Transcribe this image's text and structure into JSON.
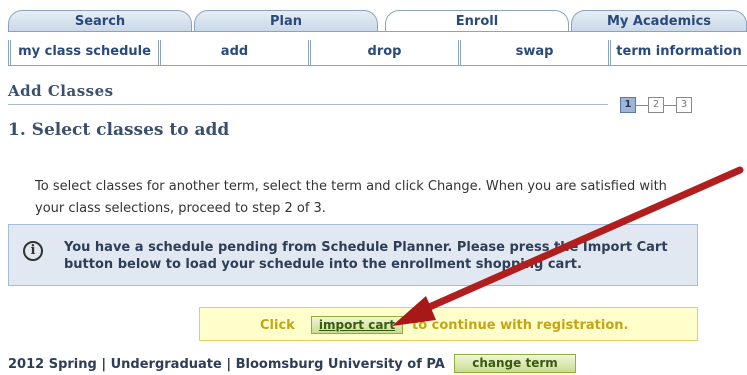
{
  "tabs": {
    "search": "Search",
    "plan": "Plan",
    "enroll": "Enroll",
    "my_academics": "My Academics"
  },
  "subtabs": {
    "my_class_schedule": "my class schedule",
    "add": "add",
    "drop": "drop",
    "swap": "swap",
    "term_information": "term information"
  },
  "page": {
    "title": "Add Classes",
    "step_heading": "1.  Select classes to add",
    "steps": [
      "1",
      "2",
      "3"
    ],
    "active_step": 1,
    "intro_text": "To select classes for another term, select the term and click Change.  When you are satisfied with your class selections, proceed to step 2 of 3."
  },
  "info": {
    "icon": "info-icon",
    "message": "You have a schedule pending from Schedule Planner. Please press the Import Cart button below to load your schedule into the enrollment shopping cart."
  },
  "import": {
    "click_label": "Click",
    "button_label": "import cart",
    "continue_text": "to continue with registration."
  },
  "term": {
    "text": "2012 Spring | Undergraduate | Bloomsburg University of PA",
    "change_button": "change term"
  },
  "colors": {
    "tab_text": "#2a4a7a",
    "info_bg": "#e1e8f2",
    "import_bg": "#ffffcc",
    "button_green": "#c9dd8f",
    "arrow_red": "#b22222"
  }
}
